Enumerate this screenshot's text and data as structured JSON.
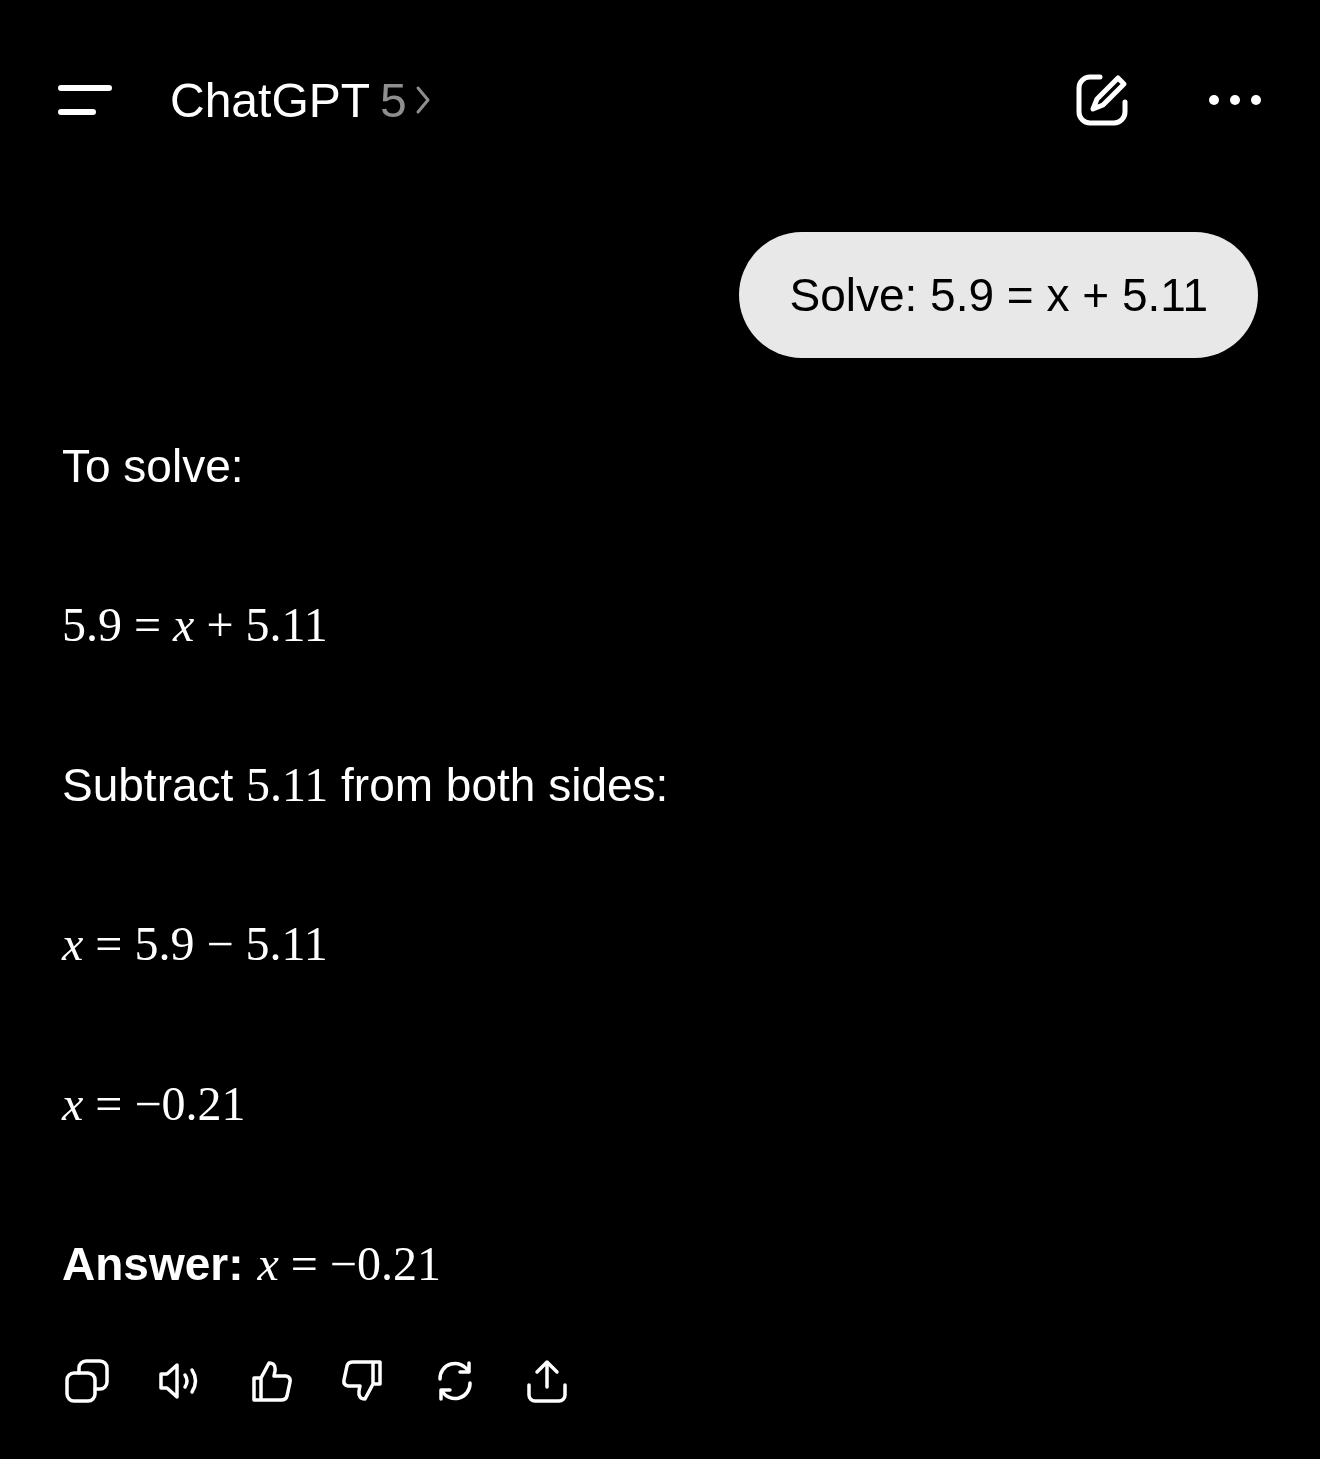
{
  "header": {
    "title": "ChatGPT",
    "model": "5"
  },
  "user_message": {
    "text": "Solve: 5.9 = x + 5.11"
  },
  "response": [
    {
      "kind": "text",
      "parts": [
        {
          "kind": "text",
          "text": "To solve:"
        }
      ]
    },
    {
      "kind": "math",
      "parts": [
        {
          "kind": "math",
          "text": "5.9 = *x* + 5.11"
        }
      ]
    },
    {
      "kind": "text",
      "parts": [
        {
          "kind": "text",
          "text": "Subtract "
        },
        {
          "kind": "math",
          "text": "5.11"
        },
        {
          "kind": "text",
          "text": " from both sides:"
        }
      ]
    },
    {
      "kind": "math",
      "parts": [
        {
          "kind": "math",
          "text": "*x* = 5.9 − 5.11"
        }
      ]
    },
    {
      "kind": "math",
      "parts": [
        {
          "kind": "math",
          "text": "*x* = −0.21"
        }
      ]
    },
    {
      "kind": "text",
      "parts": [
        {
          "kind": "bold",
          "text": "Answer:"
        },
        {
          "kind": "math",
          "text": "*x* = −0.21"
        }
      ]
    }
  ],
  "actions": [
    {
      "kind": "copy"
    },
    {
      "kind": "speaker"
    },
    {
      "kind": "thumbs-up"
    },
    {
      "kind": "thumbs-down"
    },
    {
      "kind": "regenerate"
    },
    {
      "kind": "share"
    }
  ]
}
